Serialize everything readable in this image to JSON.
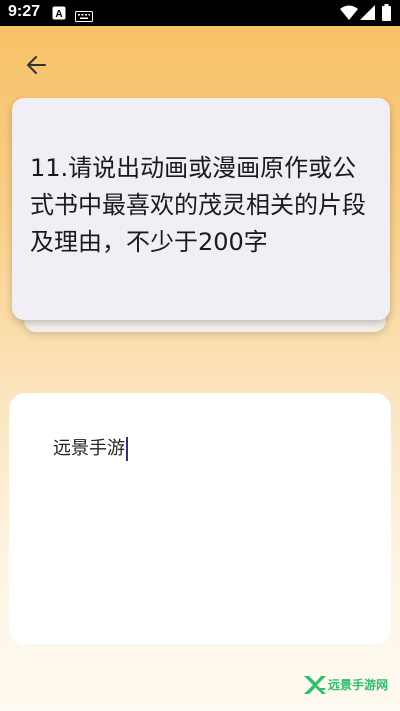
{
  "status_bar": {
    "time": "9:27",
    "icons": [
      "a-notification-icon",
      "keyboard-icon",
      "wifi-icon",
      "signal-icon",
      "battery-icon"
    ]
  },
  "header": {
    "back_icon": "arrow-left-icon"
  },
  "question": {
    "text": "11.请说出动画或漫画原作或公式书中最喜欢的茂灵相关的片段及理由，不少于200字"
  },
  "answer": {
    "value": "远景手游"
  },
  "watermark": {
    "text": "远景手游网"
  },
  "colors": {
    "gradient_top": "#f7c064",
    "gradient_bottom": "#fffaf2",
    "card": "#f2eef6",
    "caret": "#3b2a80",
    "watermark": "#2fbf6a"
  }
}
